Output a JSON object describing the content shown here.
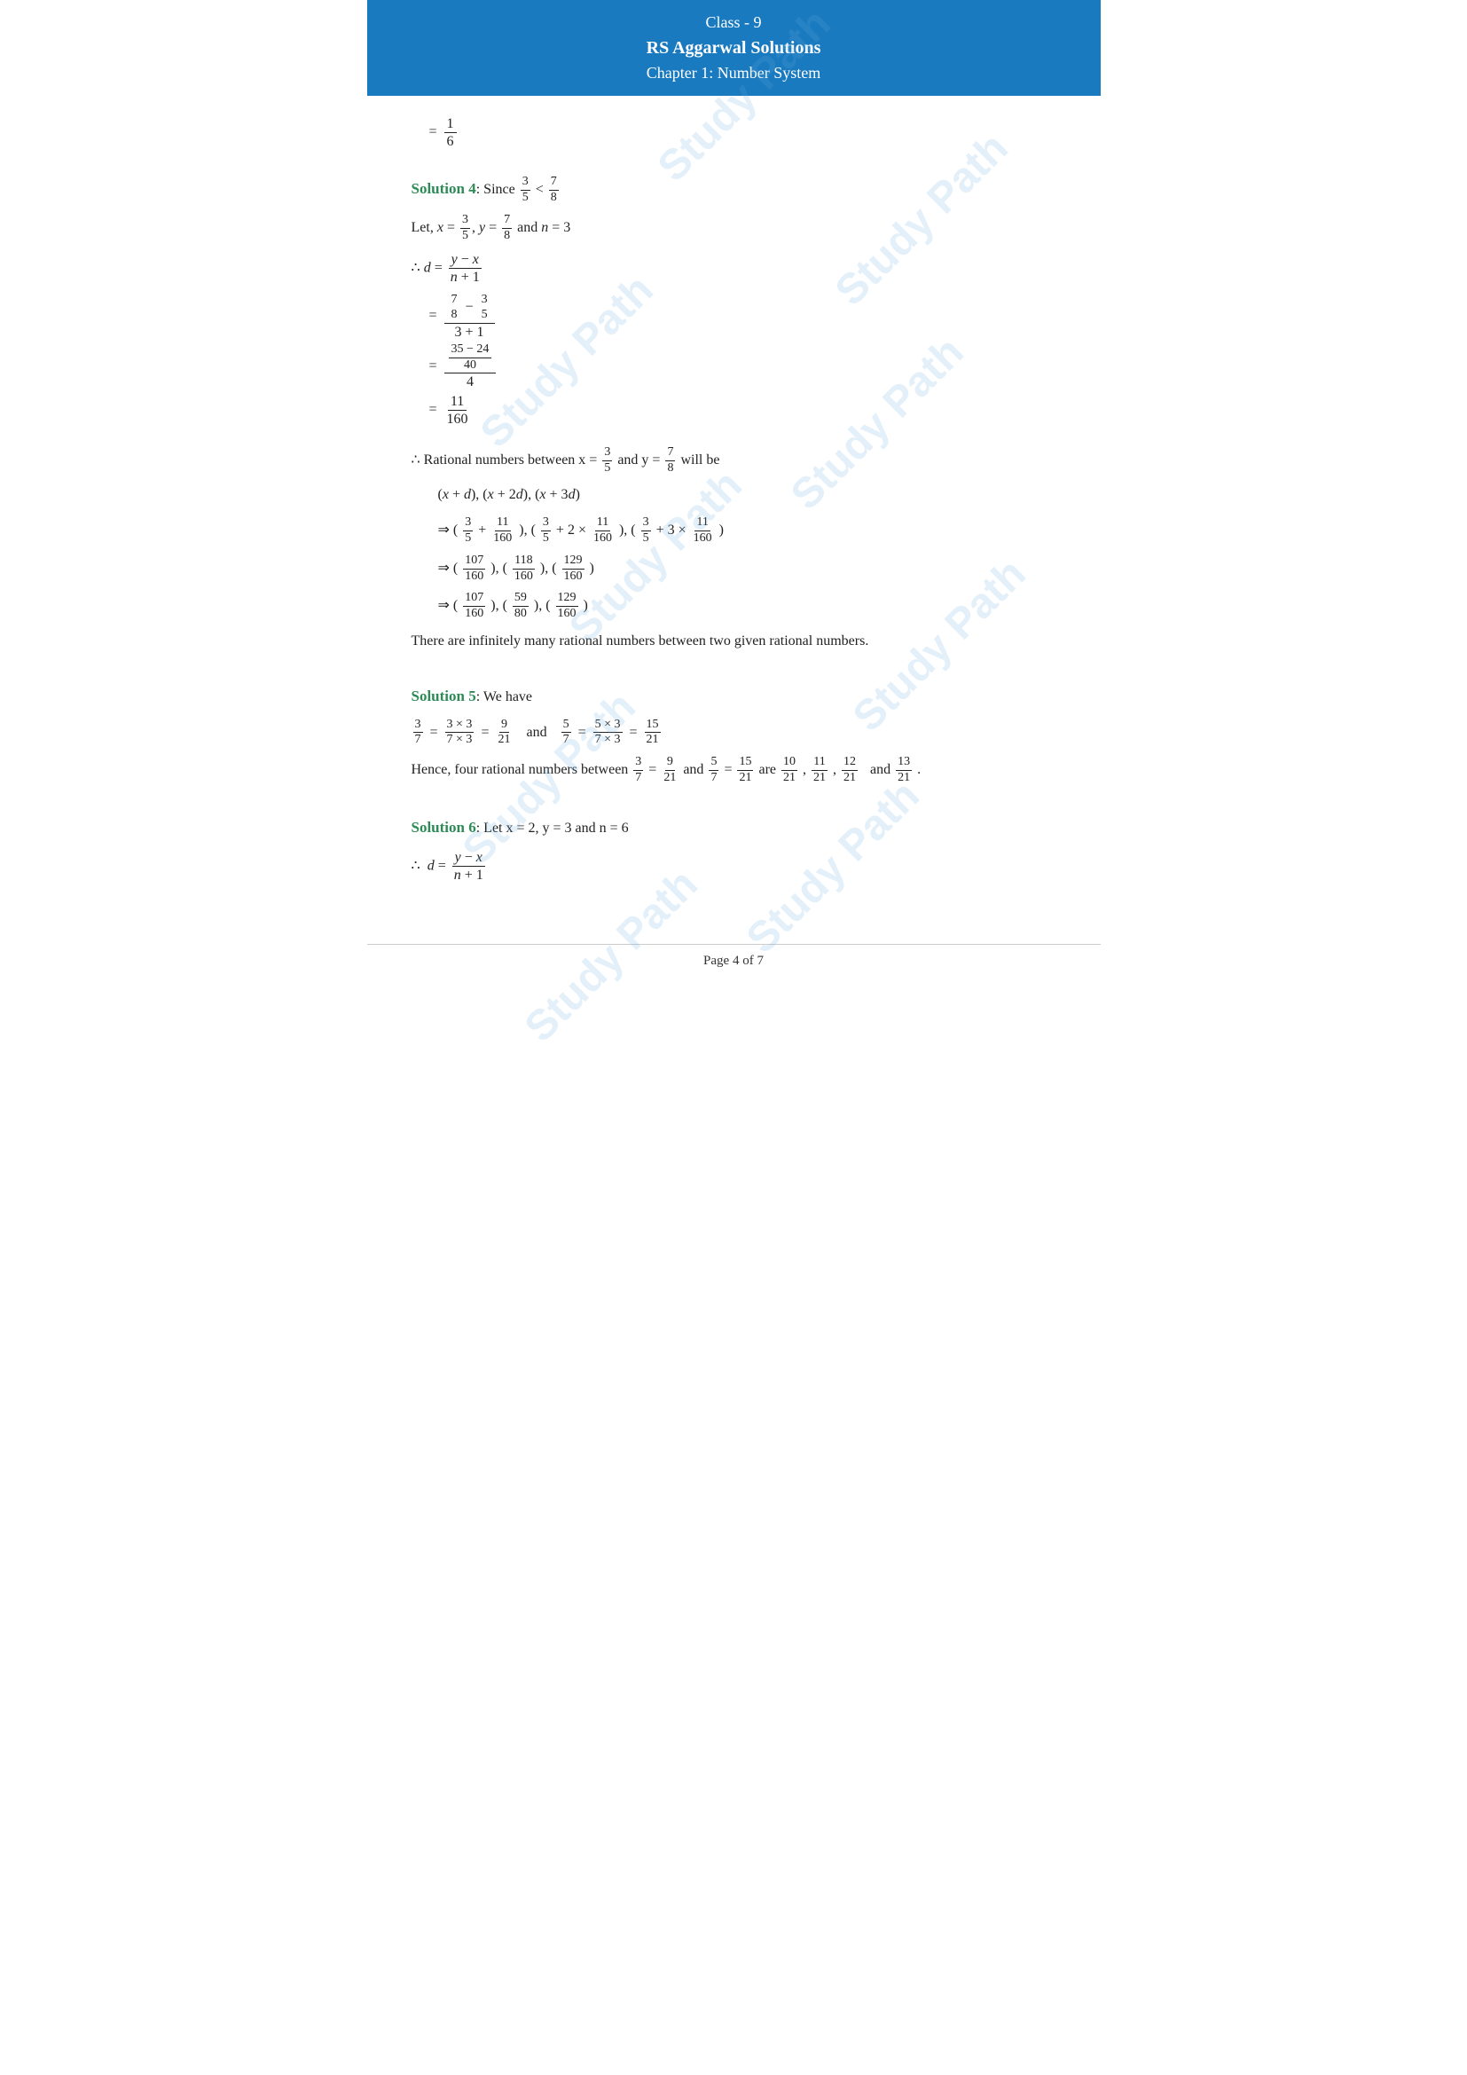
{
  "header": {
    "line1": "Class - 9",
    "line2": "RS Aggarwal Solutions",
    "line3": "Chapter 1: Number System"
  },
  "footer": {
    "text": "Page 4 of 7"
  },
  "watermark_text": "Study Path",
  "solution4_label": "Solution 4",
  "solution5_label": "Solution 5",
  "solution6_label": "Solution 6"
}
